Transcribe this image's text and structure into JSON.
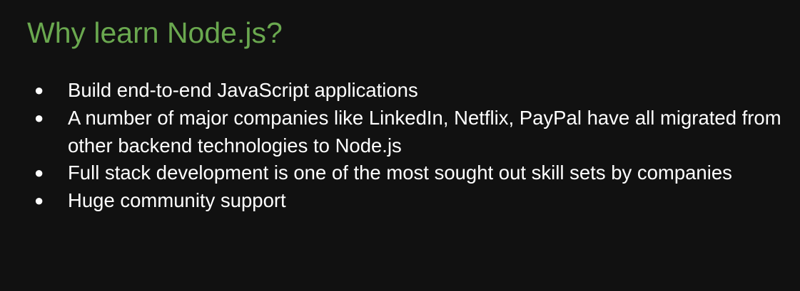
{
  "slide": {
    "title": "Why learn Node.js?",
    "bullet_glyph": "●",
    "bullets": [
      "Build end-to-end JavaScript applications",
      "A number of major companies like LinkedIn, Netflix, PayPal have all migrated from other backend technologies to Node.js",
      "Full stack development is one of the most sought out skill sets by companies",
      "Huge community support"
    ]
  },
  "colors": {
    "background": "#111111",
    "title": "#6aa84f",
    "text": "#ffffff"
  }
}
